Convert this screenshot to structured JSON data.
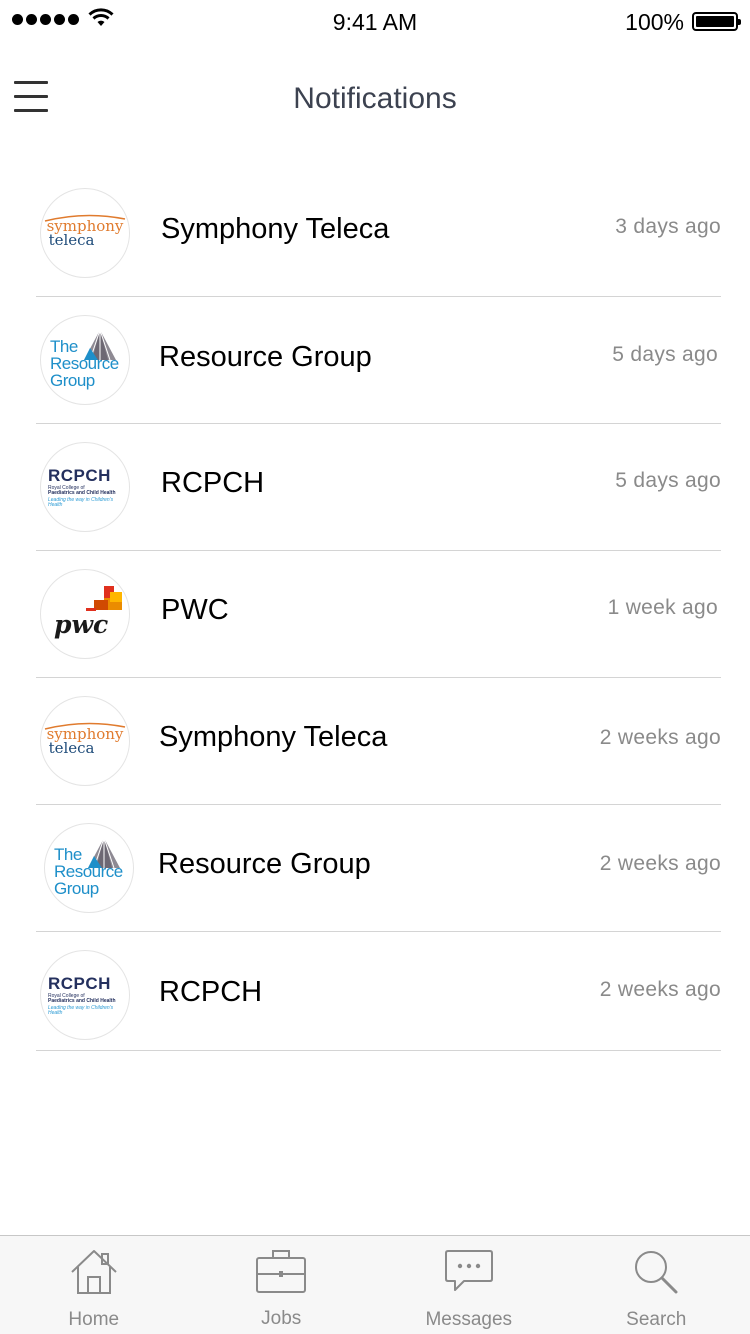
{
  "status_bar": {
    "time": "9:41 AM",
    "battery_percent": "100%",
    "signal_bars": 5
  },
  "header": {
    "title": "Notifications"
  },
  "notifications": [
    {
      "company": "Symphony Teleca",
      "time": "3 days ago",
      "logo": "symphony-teleca",
      "logo_lines": [
        "symphony",
        "teleca"
      ]
    },
    {
      "company": "Resource Group",
      "time": "5 days ago",
      "logo": "resource-group",
      "logo_lines": [
        "The",
        "Resource",
        "Group"
      ]
    },
    {
      "company": "RCPCH",
      "time": "5 days ago",
      "logo": "rcpch",
      "logo_lines": [
        "RCPCH",
        "Royal College of",
        "Paediatrics and Child Health",
        "Leading the way in Children's Health"
      ]
    },
    {
      "company": "PWC",
      "time": "1 week ago",
      "logo": "pwc",
      "logo_lines": [
        "pwc"
      ]
    },
    {
      "company": "Symphony Teleca",
      "time": "2 weeks ago",
      "logo": "symphony-teleca",
      "logo_lines": [
        "symphony",
        "teleca"
      ]
    },
    {
      "company": "Resource Group",
      "time": "2 weeks ago",
      "logo": "resource-group",
      "logo_lines": [
        "The",
        "Resource",
        "Group"
      ]
    },
    {
      "company": "RCPCH",
      "time": "2 weeks ago",
      "logo": "rcpch",
      "logo_lines": [
        "RCPCH",
        "Royal College of",
        "Paediatrics and Child Health",
        "Leading the way in Children's Health"
      ]
    }
  ],
  "tab_bar": {
    "tabs": [
      {
        "label": "Home",
        "icon": "home-icon"
      },
      {
        "label": "Jobs",
        "icon": "briefcase-icon"
      },
      {
        "label": "Messages",
        "icon": "chat-bubble-icon"
      },
      {
        "label": "Search",
        "icon": "search-icon"
      }
    ]
  },
  "colors": {
    "title": "#3c4250",
    "secondary_text": "#8a8a8a",
    "divider": "#d4d4d4",
    "tab_bar_bg": "#f7f7f7",
    "symphony_orange": "#e07b2e",
    "resource_blue": "#1e8fc9",
    "rcpch_navy": "#24305e",
    "pwc_orange": "#f26b1d"
  }
}
